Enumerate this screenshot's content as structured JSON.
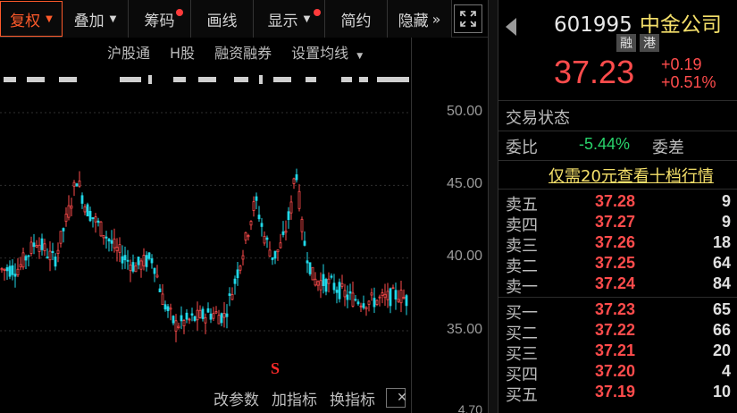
{
  "toolbar": {
    "items": [
      {
        "label": "复权",
        "caret": "▼"
      },
      {
        "label": "叠加",
        "caret": "▼"
      },
      {
        "label": "筹码"
      },
      {
        "label": "画线"
      },
      {
        "label": "显示",
        "caret": "▼"
      },
      {
        "label": "简约"
      },
      {
        "label": "隐藏"
      }
    ],
    "hide_arrows": "»",
    "expand_icon": "expand-icon"
  },
  "subbar": {
    "items": [
      "沪股通",
      "H股",
      "融资融券",
      "设置均线"
    ],
    "caret": "▼"
  },
  "chart": {
    "y_ticks": [
      "50.00",
      "45.00",
      "40.00",
      "35.00"
    ],
    "bottom_tick": "4.70",
    "s_marker": "S",
    "up_color": "#ff4c4c",
    "down_color": "#20d8e8"
  },
  "bottom_bar": {
    "params": "改参数",
    "add_indicator": "加指标",
    "switch_indicator": "换指标",
    "close": "✕"
  },
  "quote": {
    "code": "601995",
    "name": "中金公司",
    "badges": [
      "融",
      "港"
    ],
    "price": "37.23",
    "change": "+0.19",
    "change_pct": "+0.51%",
    "trade_status_label": "交易状态",
    "weibi_label": "委比",
    "weibi_value": "-5.44%",
    "weicha_label": "委差",
    "promo": "仅需20元查看十档行情",
    "asks": [
      {
        "label": "卖五",
        "price": "37.28",
        "vol": "9"
      },
      {
        "label": "卖四",
        "price": "37.27",
        "vol": "9"
      },
      {
        "label": "卖三",
        "price": "37.26",
        "vol": "18"
      },
      {
        "label": "卖二",
        "price": "37.25",
        "vol": "64"
      },
      {
        "label": "卖一",
        "price": "37.24",
        "vol": "84"
      }
    ],
    "bids": [
      {
        "label": "买一",
        "price": "37.23",
        "vol": "65"
      },
      {
        "label": "买二",
        "price": "37.22",
        "vol": "66"
      },
      {
        "label": "买三",
        "price": "37.21",
        "vol": "20"
      },
      {
        "label": "买四",
        "price": "37.20",
        "vol": "4"
      },
      {
        "label": "买五",
        "price": "37.19",
        "vol": "10"
      }
    ]
  }
}
